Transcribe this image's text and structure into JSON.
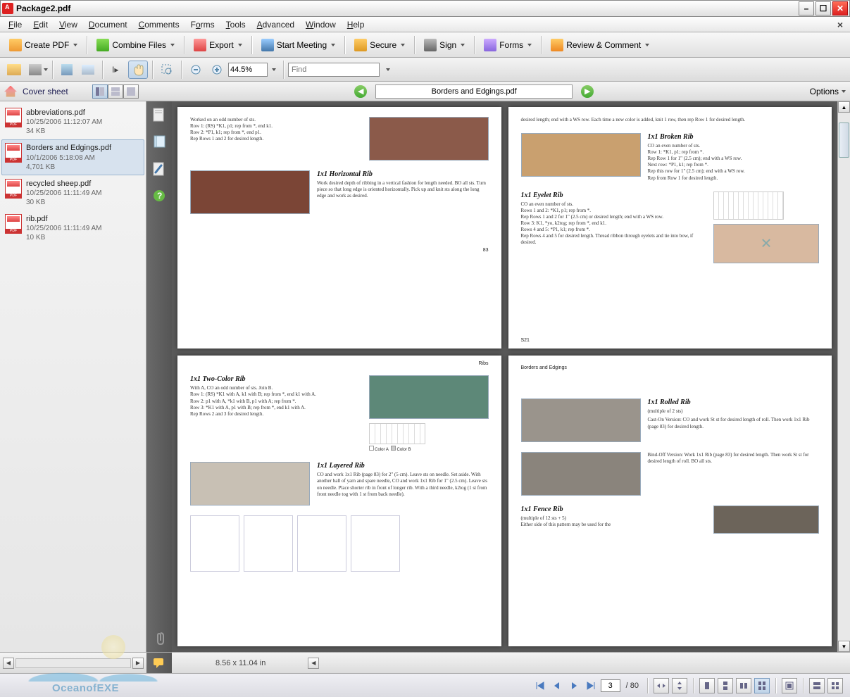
{
  "window": {
    "title": "Package2.pdf"
  },
  "menu": [
    "File",
    "Edit",
    "View",
    "Document",
    "Comments",
    "Forms",
    "Tools",
    "Advanced",
    "Window",
    "Help"
  ],
  "toolbar1": {
    "create": "Create PDF",
    "combine": "Combine Files",
    "export": "Export",
    "meeting": "Start Meeting",
    "secure": "Secure",
    "sign": "Sign",
    "forms": "Forms",
    "review": "Review & Comment"
  },
  "toolbar2": {
    "zoom": "44.5%",
    "find_placeholder": "Find"
  },
  "navbar": {
    "cover": "Cover sheet",
    "current_doc": "Borders and Edgings.pdf",
    "options": "Options"
  },
  "files": [
    {
      "name": "abbreviations.pdf",
      "date": "10/25/2006 11:12:07 AM",
      "size": "34 KB",
      "selected": false
    },
    {
      "name": "Borders and Edgings.pdf",
      "date": "10/1/2006 5:18:08 AM",
      "size": "4,701 KB",
      "selected": true
    },
    {
      "name": "recycled sheep.pdf",
      "date": "10/25/2006 11:11:49 AM",
      "size": "30 KB",
      "selected": false
    },
    {
      "name": "rib.pdf",
      "date": "10/25/2006 11:11:49 AM",
      "size": "10 KB",
      "selected": false
    }
  ],
  "pages": {
    "p1": {
      "intro": "Worked on an odd number of sts.\nRow 1: (RS) *K1, p1; rep from *, end k1.\nRow 2: *P1, k1; rep from *, end p1.\nRep Rows 1 and 2 for desired length.",
      "t2": "1x1   Horizontal   Rib",
      "b2": "Work desired depth of ribbing in a vertical fashion for length needed. BO all sts. Turn piece so that long edge is oriented horizontally. Pick up and knit sts along the long edge and work as desired.",
      "num": "83"
    },
    "p2": {
      "intro": "desired length; end with a WS row. Each time a new color is added, knit 1 row, then rep Row 1 for desired length.",
      "t1": "1x1   Broken   Rib",
      "b1": "CO an even number of sts.\nRow 1: *K1, p1; rep from *.\nRep Row 1 for 1\" (2.5 cm); end with a WS row.\nNext row: *P1, k1; rep from *.\nRep this row for 1\" (2.5 cm); end with a WS row.\nRep from Row 1 for desired length.",
      "t2": "1x1   Eyelet   Rib",
      "b2": "CO an even number of sts.\nRows 1 and 2: *K1, p1; rep from *.\nRep Rows 1 and 2 for 1\" (2.5 cm) or desired length; end with a WS row.\nRow 3: K1, *yo, k2tog; rep from *, end k1.\nRows 4 and 5: *P1, k1; rep from *.\nRep Rows 4 and 5 for desired length. Thread ribbon through eyelets and tie into bow, if desired.",
      "num": "S21"
    },
    "p3": {
      "hdr": "Ribs",
      "t1": "1x1   Two-Color   Rib",
      "b1": "With A, CO an odd number of sts. Join B.\nRow 1: (RS) *K1 with A, k1 with B; rep from *, end k1 with A.\nRow 2: p1 with A, *k1 with B, p1 with A; rep from *.\nRow 3: *K1 with A, p1 with B; rep from *, end k1 with A.\nRep Rows 2 and 3 for desired length.",
      "t2": "1x1   Layered   Rib",
      "b2": "CO and work 1x1 Rib (page 83) for 2\" (5 cm). Leave sts on needle. Set aside. With another ball of yarn and spare needle, CO and work 1x1 Rib for 1\" (2.5 cm). Leave sts on needle. Place shorter rib in front of longer rib. With a third needle, k2tog (1 st from front needle tog with 1 st from back needle).",
      "leg_a": "Color A",
      "leg_b": "Color B"
    },
    "p4": {
      "hdr": "Borders and Edgings",
      "t1": "1x1   Rolled   Rib",
      "sub1": "(multiple of 2 sts)",
      "b1a": "Cast-On Version: CO and work St st for desired length of roll. Then work 1x1 Rib (page 83) for desired length.",
      "b1b": "Bind-Off Version: Work 1x1 Rib (page 83) for desired length. Then work St st for desired length of roll. BO all sts.",
      "t2": "1x1   Fence   Rib",
      "sub2": "(multiple of 12 sts + 5)",
      "b2": "Either side of this pattern may be used for the"
    }
  },
  "status": {
    "dims": "8.56 x 11.04 in"
  },
  "bottom": {
    "page": "3",
    "total": "/ 80"
  },
  "watermark": "OceanofEXE"
}
